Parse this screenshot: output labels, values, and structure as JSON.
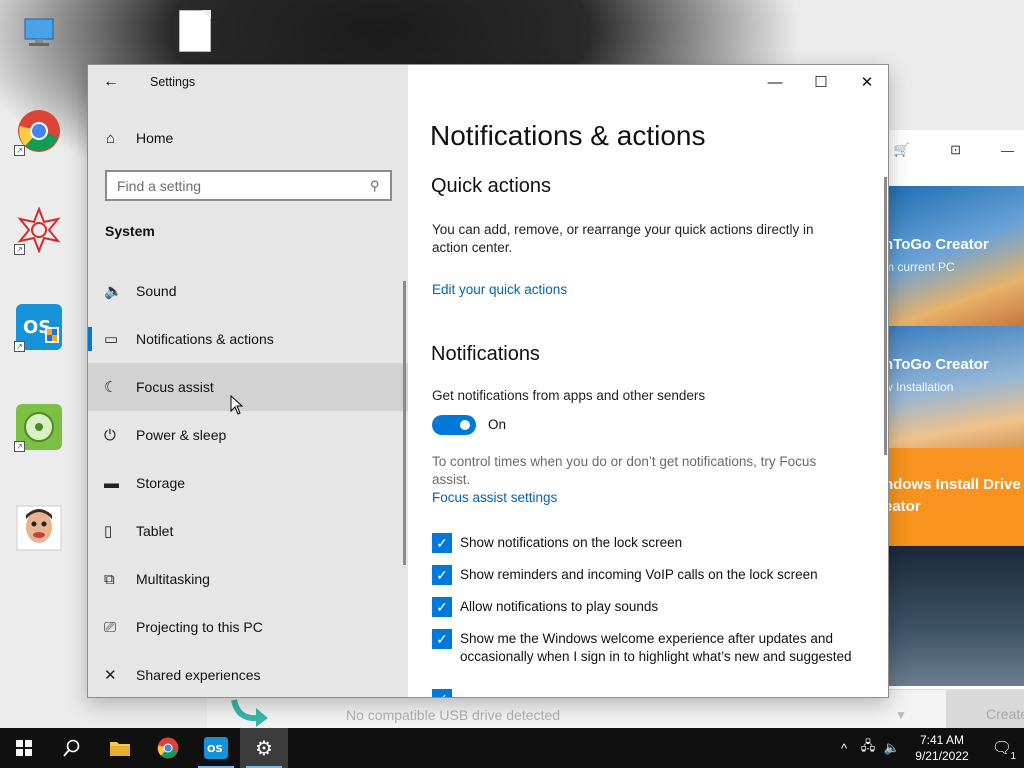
{
  "desktop": {
    "icons": [
      {
        "name": "this-pc-icon",
        "glyph": "🖥"
      },
      {
        "name": "chrome-icon",
        "glyph": "●"
      },
      {
        "name": "mathematica-icon",
        "glyph": "✺"
      },
      {
        "name": "os-tool-icon",
        "glyph": "OS"
      },
      {
        "name": "disk-tool-icon",
        "glyph": "◎"
      },
      {
        "name": "photo-icon",
        "glyph": "☺"
      }
    ]
  },
  "bg_app": {
    "tiles": [
      {
        "title": "nToGo Creator",
        "sub": "m current PC"
      },
      {
        "title": "nToGo Creator",
        "sub": "w Installation"
      },
      {
        "title": "ndows Install Drive",
        "sub": "eator"
      }
    ],
    "usb_status": "No compatible USB drive detected",
    "create_label": "Create"
  },
  "settings": {
    "app_title": "Settings",
    "home_label": "Home",
    "search_placeholder": "Find a setting",
    "section_title": "System",
    "nav_items": [
      {
        "label": "Sound",
        "icon": "speaker-icon",
        "glyph": "🔊"
      },
      {
        "label": "Notifications & actions",
        "icon": "message-icon",
        "glyph": "🗨"
      },
      {
        "label": "Focus assist",
        "icon": "moon-icon",
        "glyph": "☾"
      },
      {
        "label": "Power & sleep",
        "icon": "power-icon",
        "glyph": "⏻"
      },
      {
        "label": "Storage",
        "icon": "storage-icon",
        "glyph": "▭"
      },
      {
        "label": "Tablet",
        "icon": "tablet-icon",
        "glyph": "▯"
      },
      {
        "label": "Multitasking",
        "icon": "multitasking-icon",
        "glyph": "⧉"
      },
      {
        "label": "Projecting to this PC",
        "icon": "projector-icon",
        "glyph": "⎚"
      },
      {
        "label": "Shared experiences",
        "icon": "shared-icon",
        "glyph": "✕"
      }
    ],
    "page_title": "Notifications & actions",
    "quick_actions": {
      "heading": "Quick actions",
      "description": "You can add, remove, or rearrange your quick actions directly in action center.",
      "link": "Edit your quick actions"
    },
    "notifications": {
      "heading": "Notifications",
      "toggle_label": "Get notifications from apps and other senders",
      "toggle_state": "On",
      "focus_hint": "To control times when you do or don’t get notifications, try Focus assist.",
      "focus_link": "Focus assist settings",
      "checkboxes": [
        "Show notifications on the lock screen",
        "Show reminders and incoming VoIP calls on the lock screen",
        "Allow notifications to play sounds",
        "Show me the Windows welcome experience after updates and occasionally when I sign in to highlight what’s new and suggested"
      ]
    }
  },
  "taskbar": {
    "time": "7:41 AM",
    "date": "9/21/2022",
    "notification_count": "1"
  }
}
